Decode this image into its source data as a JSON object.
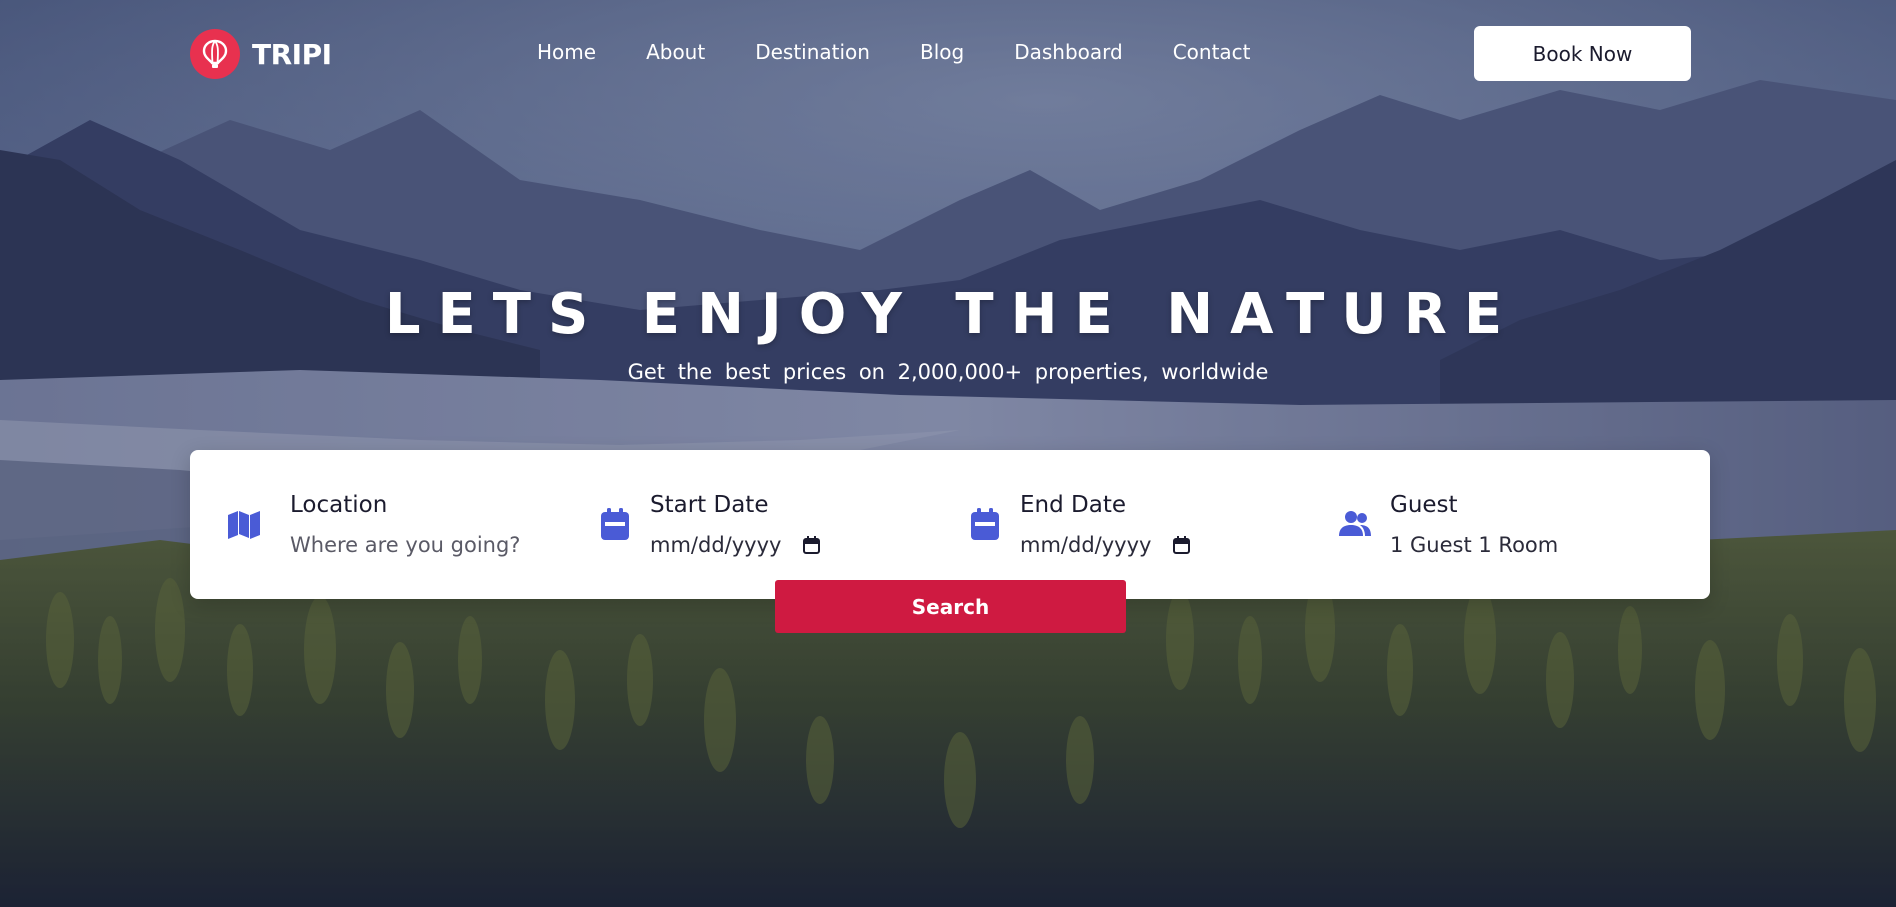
{
  "brand": {
    "name": "TRIPI",
    "badge_color": "#e8314f",
    "icon": "hot-air-balloon-icon"
  },
  "nav": {
    "links": [
      "Home",
      "About",
      "Destination",
      "Blog",
      "Dashboard",
      "Contact"
    ],
    "book_label": "Book Now"
  },
  "hero": {
    "headline": "LETS ENJOY THE NATURE",
    "subline": "Get the best prices on 2,000,000+ properties, worldwide",
    "background": "mountain-valley-river-forest-photo"
  },
  "search": {
    "location": {
      "label": "Location",
      "placeholder": "Where are you going?",
      "icon": "map-icon"
    },
    "start_date": {
      "label": "Start Date",
      "value": "mm/dd/yyyy",
      "icon": "calendar-icon"
    },
    "end_date": {
      "label": "End Date",
      "value": "mm/dd/yyyy",
      "icon": "calendar-icon"
    },
    "guest": {
      "label": "Guest",
      "value": "1 Guest 1 Room",
      "icon": "users-icon"
    },
    "button_label": "Search",
    "icon_color": "#4a5bd6",
    "button_color": "#cf1a41"
  }
}
